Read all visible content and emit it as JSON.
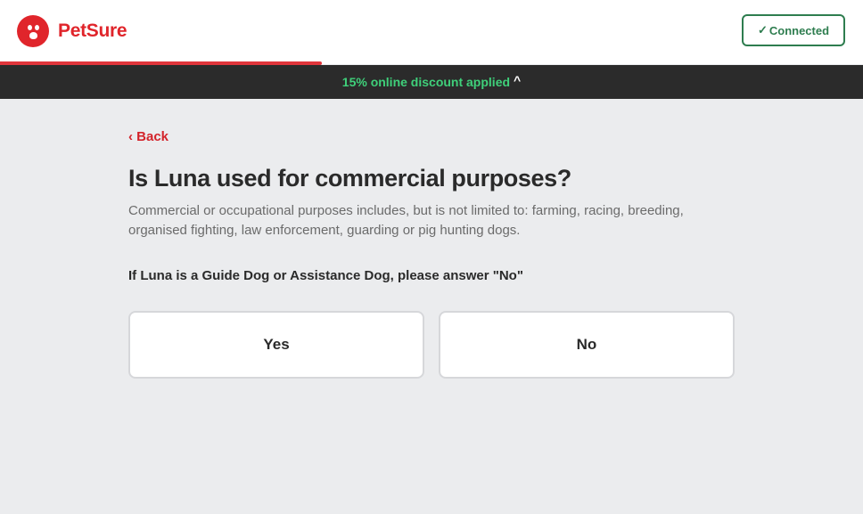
{
  "header": {
    "brand": "PetSure",
    "connected_label": "Connected",
    "connected_check": "✓"
  },
  "progress": {
    "fraction": 0.373
  },
  "discount_banner": {
    "text": "15% online discount applied",
    "toggle": "^"
  },
  "question_page": {
    "back_label": "‹ Back",
    "title": "Is Luna used for commercial purposes?",
    "description": "Commercial or occupational purposes includes, but is not limited to: farming, racing, breeding, organised fighting, law enforcement, guarding or pig hunting dogs.",
    "note": "If Luna is a Guide Dog or Assistance Dog, please answer \"No\"",
    "options": [
      {
        "label": "Yes"
      },
      {
        "label": "No"
      }
    ]
  },
  "colors": {
    "brand_red": "#e0252b",
    "connected_green": "#2e7d4f",
    "discount_green": "#3fd07a",
    "banner_bg": "#2b2b2b",
    "page_bg": "#ebecee"
  }
}
